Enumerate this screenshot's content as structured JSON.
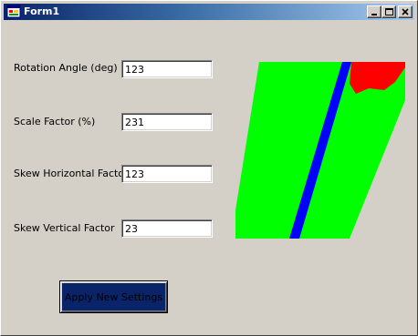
{
  "window": {
    "title": "Form1",
    "app_icon": "form-icon",
    "controls": {
      "minimize_icon": "minimize-icon",
      "maximize_icon": "maximize-icon",
      "close_icon": "close-icon"
    }
  },
  "form": {
    "fields": [
      {
        "label": "Rotation Angle (deg)",
        "value": "123"
      },
      {
        "label": "Scale Factor (%)",
        "value": "231"
      },
      {
        "label": "Skew Horizontal Factor",
        "value": "123"
      },
      {
        "label": "Skew Vertical Factor",
        "value": "23"
      }
    ],
    "apply_button_label": "Apply New Settings"
  },
  "preview": {
    "colors": {
      "field": "#00ff00",
      "stripe": "#0000ff",
      "corner": "#ff0000"
    }
  },
  "colors": {
    "window_bg": "#d4d0c8",
    "titlebar_start": "#0a246a",
    "titlebar_end": "#a6caf0",
    "button_bg": "#0a246a"
  }
}
